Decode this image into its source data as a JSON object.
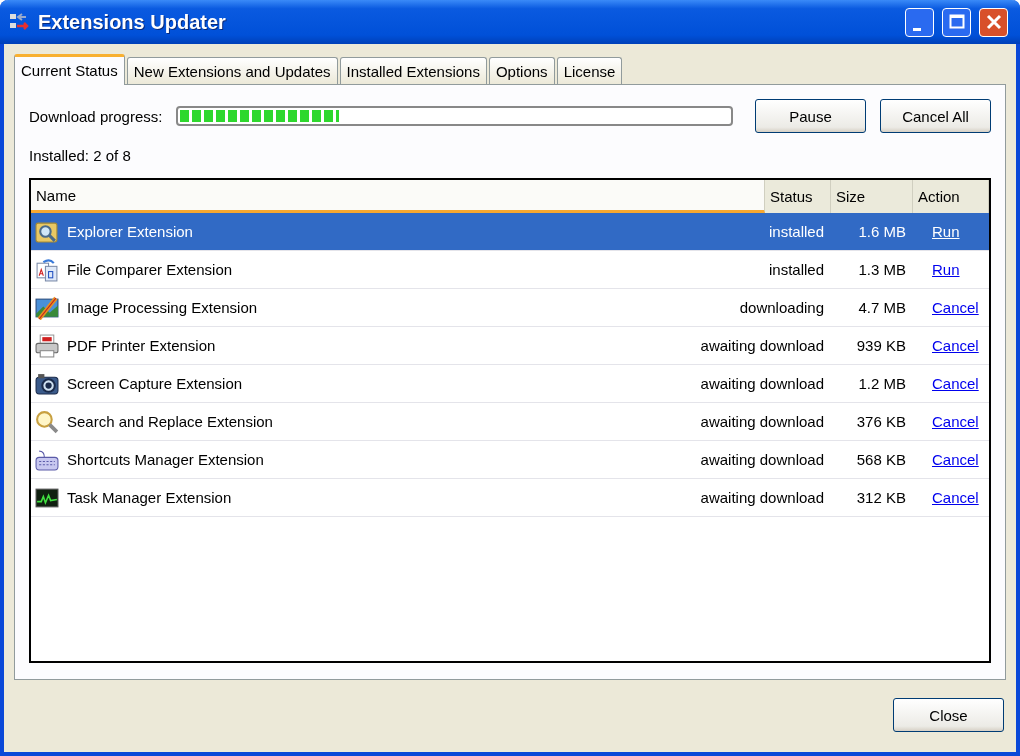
{
  "window": {
    "title": "Extensions Updater"
  },
  "tabs": [
    {
      "label": "Current Status",
      "selected": true
    },
    {
      "label": "New Extensions and Updates",
      "selected": false
    },
    {
      "label": "Installed Extensions",
      "selected": false
    },
    {
      "label": "Options",
      "selected": false
    },
    {
      "label": "License",
      "selected": false
    }
  ],
  "progress": {
    "label": "Download progress:",
    "level": 0.29
  },
  "buttons": [
    "Pause",
    "Cancel All"
  ],
  "installed_count": "Installed: 2 of 8",
  "table": {
    "columns": [
      {
        "label": "Name",
        "sorted": true
      },
      {
        "label": "Status",
        "sorted": false
      },
      {
        "label": "Size",
        "sorted": false
      },
      {
        "label": "Action",
        "sorted": false
      }
    ],
    "rows": [
      {
        "name": "Explorer Extension",
        "status": "installed",
        "size": "1.6 MB",
        "action": "Run",
        "selected": true
      },
      {
        "name": "File Comparer Extension",
        "status": "installed",
        "size": "1.3 MB",
        "action": "Run",
        "selected": false
      },
      {
        "name": "Image Processing Extension",
        "status": "downloading",
        "size": "4.7 MB",
        "action": "Cancel",
        "selected": false
      },
      {
        "name": "PDF Printer Extension",
        "status": "awaiting download",
        "size": "939 KB",
        "action": "Cancel",
        "selected": false
      },
      {
        "name": "Screen Capture Extension",
        "status": "awaiting download",
        "size": "1.2 MB",
        "action": "Cancel",
        "selected": false
      },
      {
        "name": "Search and Replace Extension",
        "status": "awaiting download",
        "size": "376 KB",
        "action": "Cancel",
        "selected": false
      },
      {
        "name": "Shortcuts Manager Extension",
        "status": "awaiting download",
        "size": "568 KB",
        "action": "Cancel",
        "selected": false
      },
      {
        "name": "Task Manager Extension",
        "status": "awaiting download",
        "size": "312 KB",
        "action": "Cancel",
        "selected": false
      }
    ]
  },
  "close_button": "Close"
}
